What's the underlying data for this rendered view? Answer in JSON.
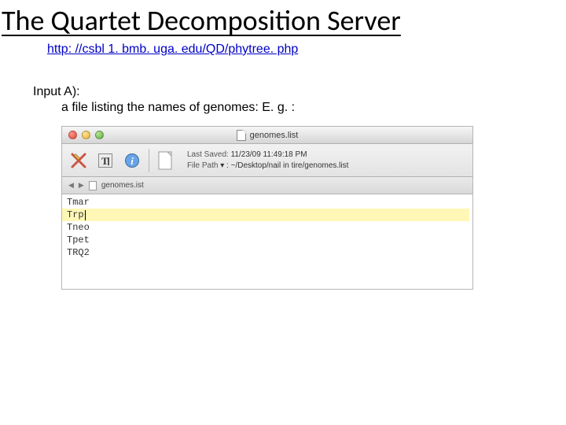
{
  "title": "The Quartet Decomposition Server",
  "url": "http: //csbl 1. bmb. uga. edu/QD/phytree. php",
  "input_label": "Input A):",
  "input_desc": "a file listing the names of genomes: E. g. :",
  "window": {
    "filename": "genomes.list",
    "info": {
      "last_saved_label": "Last Saved:",
      "last_saved_value": "11/23/09 11:49:18 PM",
      "file_path_label": "File Path",
      "file_path_value": "▾ : ~/Desktop/nail in tire/genomes.list"
    },
    "tab_label": "genomes.ist",
    "lines": [
      "Tmar",
      "Trp",
      "Tneo",
      "Tpet",
      "TRQ2"
    ]
  }
}
